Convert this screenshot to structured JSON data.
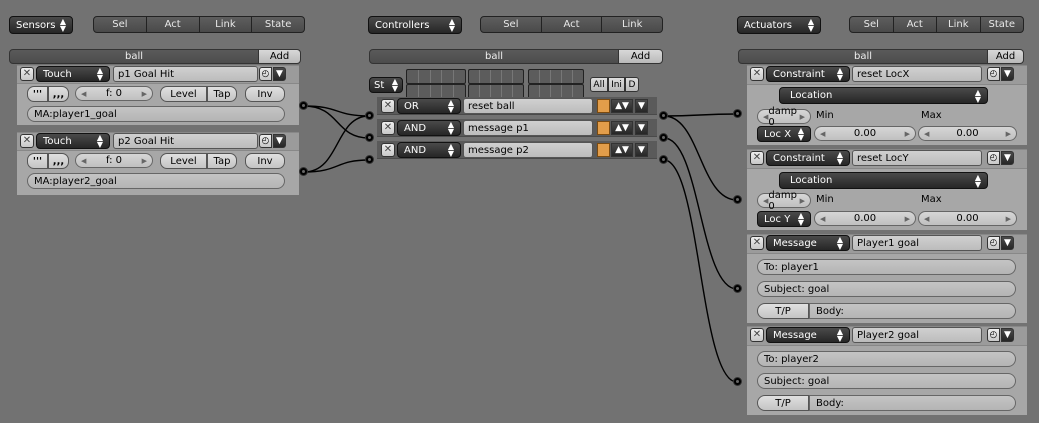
{
  "sensors": {
    "menu_label": "Sensors",
    "header_buttons": [
      "Sel",
      "Act",
      "Link",
      "State"
    ],
    "object_name": "ball",
    "add_label": "Add",
    "items": [
      {
        "type": "Touch",
        "name": "p1 Goal Hit",
        "freq": "f: 0",
        "level": "Level",
        "tap": "Tap",
        "inv": "Inv",
        "property": "MA:player1_goal"
      },
      {
        "type": "Touch",
        "name": "p2 Goal Hit",
        "freq": "f: 0",
        "level": "Level",
        "tap": "Tap",
        "inv": "Inv",
        "property": "MA:player2_goal"
      }
    ]
  },
  "controllers": {
    "menu_label": "Controllers",
    "header_buttons": [
      "Sel",
      "Act",
      "Link"
    ],
    "object_name": "ball",
    "add_label": "Add",
    "state_label": "St",
    "all_label": "All",
    "ini_label": "Ini",
    "d_label": "D",
    "items": [
      {
        "type": "OR",
        "name": "reset ball"
      },
      {
        "type": "AND",
        "name": "message p1"
      },
      {
        "type": "AND",
        "name": "message p2"
      }
    ]
  },
  "actuators": {
    "menu_label": "Actuators",
    "header_buttons": [
      "Sel",
      "Act",
      "Link",
      "State"
    ],
    "object_name": "ball",
    "add_label": "Add",
    "constraints": [
      {
        "type": "Constraint",
        "name": "reset LocX",
        "mode": "Location",
        "damp": "damp 0",
        "min_label": "Min",
        "max_label": "Max",
        "axis": "Loc X",
        "min": "0.00",
        "max": "0.00"
      },
      {
        "type": "Constraint",
        "name": "reset LocY",
        "mode": "Location",
        "damp": "damp 0",
        "min_label": "Min",
        "max_label": "Max",
        "axis": "Loc Y",
        "min": "0.00",
        "max": "0.00"
      }
    ],
    "messages": [
      {
        "type": "Message",
        "name": "Player1 goal",
        "to": "To: player1",
        "subject": "Subject: goal",
        "tp": "T/P",
        "body": "Body:"
      },
      {
        "type": "Message",
        "name": "Player2 goal",
        "to": "To: player2",
        "subject": "Subject: goal",
        "tp": "T/P",
        "body": "Body:"
      }
    ]
  },
  "colors": {
    "background": "#727272",
    "panel": "#a7a7a7",
    "lock_icon": "#e29d4a"
  }
}
